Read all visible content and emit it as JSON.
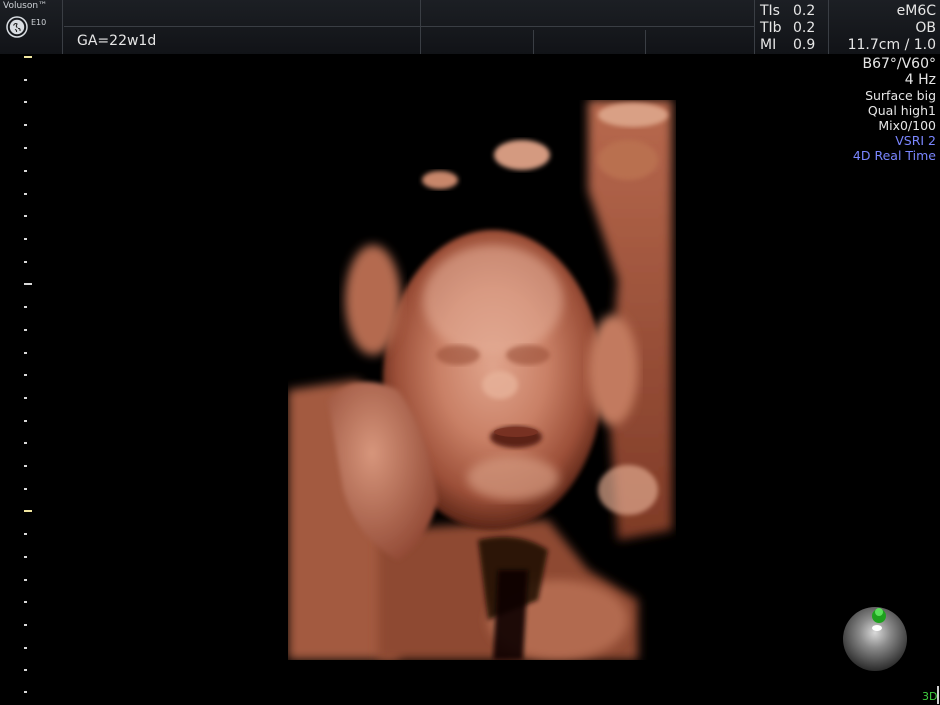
{
  "header": {
    "brand": "Voluson™",
    "model": "E10",
    "gestational_age": "GA=22w1d",
    "metrics": [
      {
        "label": "TIs",
        "value": "0.2"
      },
      {
        "label": "TIb",
        "value": "0.2"
      },
      {
        "label": "MI",
        "value": "0.9"
      }
    ],
    "probe": "eM6C",
    "preset": "OB",
    "depth_scale": "11.7cm / 1.0"
  },
  "parameters": {
    "angle": "B67°/V60°",
    "frequency": "4 Hz",
    "surface": "Surface big",
    "quality": "Qual high1",
    "mix": "Mix0/100",
    "vsri": "VSRI 2",
    "mode": "4D Real Time"
  },
  "indicator": {
    "mode_tag": "3D"
  },
  "colors": {
    "accent_blue": "#7a86ff",
    "indicator_green": "#41d041",
    "tissue": "#c0735a"
  }
}
